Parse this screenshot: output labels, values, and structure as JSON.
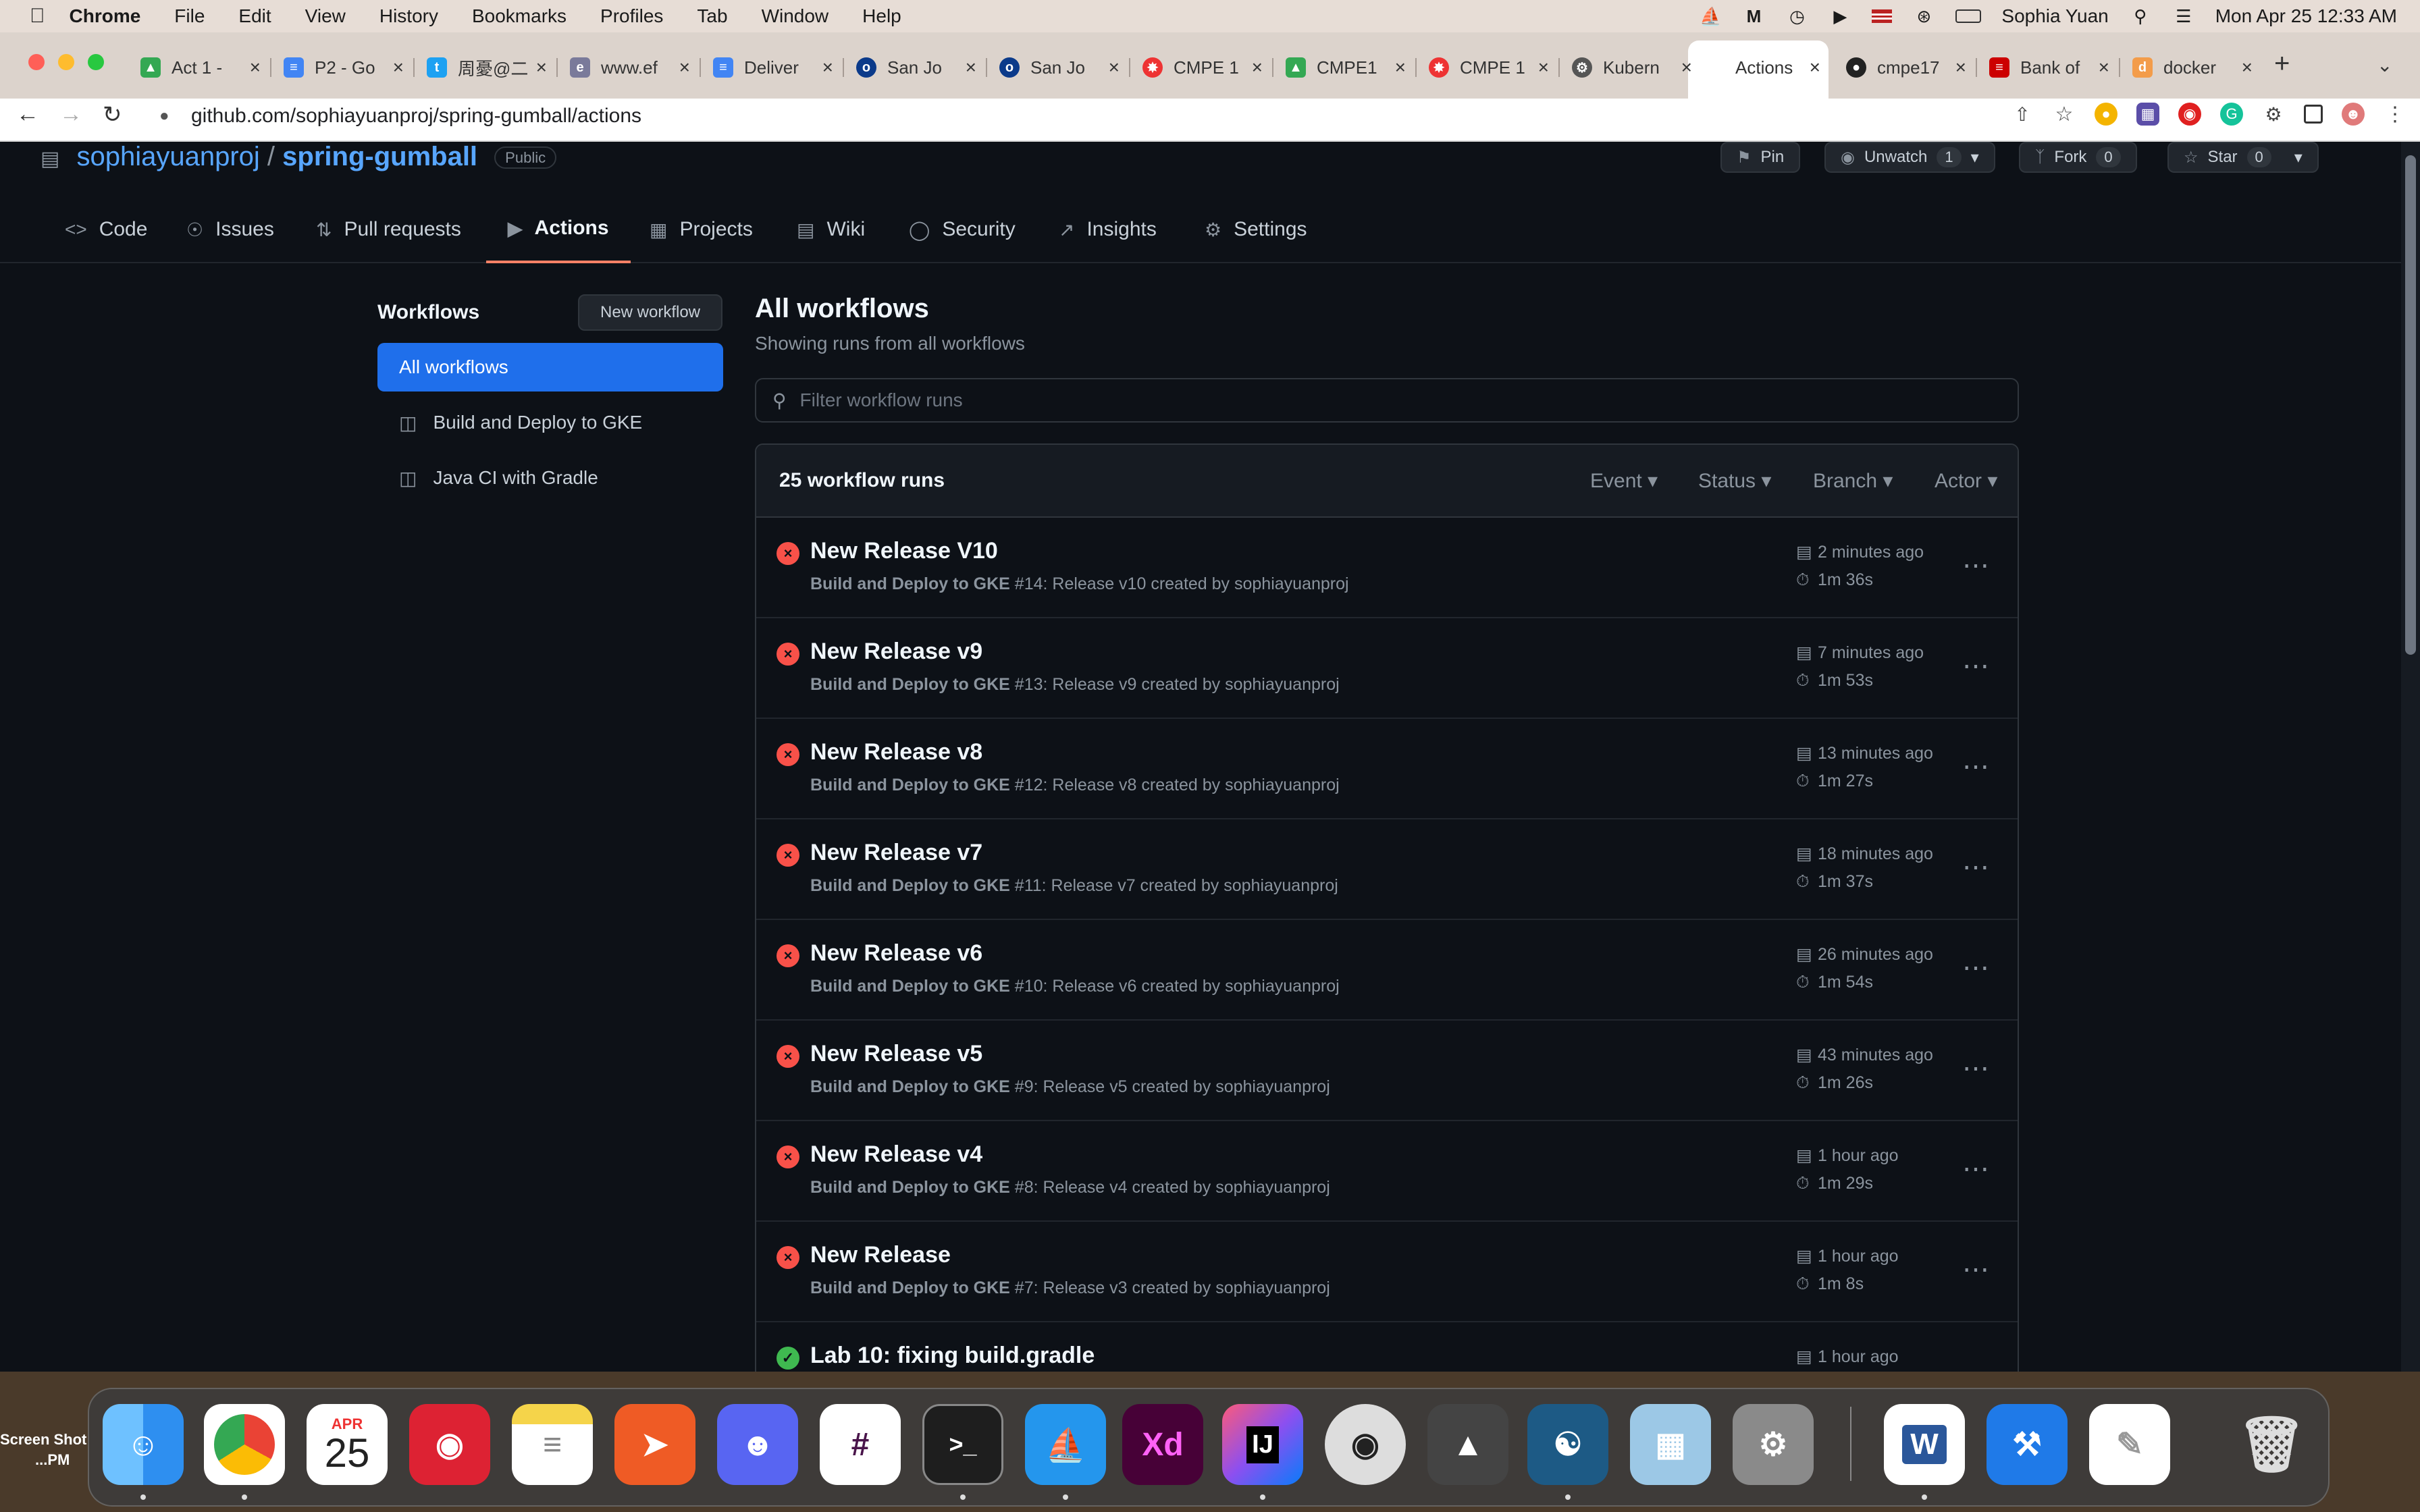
{
  "menubar": {
    "app": "Chrome",
    "items": [
      "File",
      "Edit",
      "View",
      "History",
      "Bookmarks",
      "Profiles",
      "Tab",
      "Window",
      "Help"
    ],
    "user": "Sophia Yuan",
    "datetime": "Mon Apr 25  12:33 AM"
  },
  "chrome": {
    "tabs": [
      {
        "label": "Act 1 - ",
        "icon": "google-drive-icon"
      },
      {
        "label": "P2 - Go",
        "icon": "google-docs-icon"
      },
      {
        "label": "周憂@二",
        "icon": "twitter-icon"
      },
      {
        "label": "www.ef",
        "icon": "globe-icon"
      },
      {
        "label": "Deliver",
        "icon": "google-docs-icon"
      },
      {
        "label": "San Jo",
        "icon": "sjsu-icon"
      },
      {
        "label": "San Jo",
        "icon": "sjsu-icon"
      },
      {
        "label": "CMPE 1",
        "icon": "canvas-icon"
      },
      {
        "label": "CMPE1",
        "icon": "google-drive-icon"
      },
      {
        "label": "CMPE 1",
        "icon": "canvas-icon"
      },
      {
        "label": "Kubern",
        "icon": "gear-icon"
      },
      {
        "label": "Actions",
        "icon": "github-icon",
        "active": true
      },
      {
        "label": "cmpe17",
        "icon": "github-icon"
      },
      {
        "label": "Bank of",
        "icon": "bank-icon"
      },
      {
        "label": "docker",
        "icon": "docker-icon"
      }
    ],
    "url": "github.com/sophiayuanproj/spring-gumball/actions"
  },
  "repo": {
    "owner": "sophiayuanproj",
    "name": "spring-gumball",
    "visibility": "Public",
    "pin_label": "Pin",
    "unwatch_label": "Unwatch",
    "watch_count": "1",
    "fork_label": "Fork",
    "fork_count": "0",
    "star_label": "Star",
    "star_count": "0"
  },
  "repo_nav": [
    {
      "label": "Code",
      "icon": "code-icon"
    },
    {
      "label": "Issues",
      "icon": "issue-icon"
    },
    {
      "label": "Pull requests",
      "icon": "pull-request-icon"
    },
    {
      "label": "Actions",
      "icon": "play-icon",
      "active": true
    },
    {
      "label": "Projects",
      "icon": "table-icon"
    },
    {
      "label": "Wiki",
      "icon": "book-icon"
    },
    {
      "label": "Security",
      "icon": "shield-icon"
    },
    {
      "label": "Insights",
      "icon": "graph-icon"
    },
    {
      "label": "Settings",
      "icon": "gear-icon"
    }
  ],
  "sidebar": {
    "title": "Workflows",
    "new_workflow": "New workflow",
    "items": [
      {
        "label": "All workflows",
        "active": true
      },
      {
        "label": "Build and Deploy to GKE"
      },
      {
        "label": "Java CI with Gradle"
      }
    ]
  },
  "main": {
    "title": "All workflows",
    "subtitle": "Showing runs from all workflows",
    "filter_placeholder": "Filter workflow runs",
    "runs_count": "25 workflow runs",
    "filters": [
      "Event",
      "Status",
      "Branch",
      "Actor"
    ],
    "runs": [
      {
        "title": "New Release V10",
        "workflow": "Build and Deploy to GKE",
        "detail": " #14: Release v10 created by sophiayuanproj",
        "time": "2 minutes ago",
        "duration": "1m 36s",
        "status": "failed"
      },
      {
        "title": "New Release v9",
        "workflow": "Build and Deploy to GKE",
        "detail": " #13: Release v9 created by sophiayuanproj",
        "time": "7 minutes ago",
        "duration": "1m 53s",
        "status": "failed"
      },
      {
        "title": "New Release v8",
        "workflow": "Build and Deploy to GKE",
        "detail": " #12: Release v8 created by sophiayuanproj",
        "time": "13 minutes ago",
        "duration": "1m 27s",
        "status": "failed"
      },
      {
        "title": "New Release v7",
        "workflow": "Build and Deploy to GKE",
        "detail": " #11: Release v7 created by sophiayuanproj",
        "time": "18 minutes ago",
        "duration": "1m 37s",
        "status": "failed"
      },
      {
        "title": "New Release v6",
        "workflow": "Build and Deploy to GKE",
        "detail": " #10: Release v6 created by sophiayuanproj",
        "time": "26 minutes ago",
        "duration": "1m 54s",
        "status": "failed"
      },
      {
        "title": "New Release v5",
        "workflow": "Build and Deploy to GKE",
        "detail": " #9: Release v5 created by sophiayuanproj",
        "time": "43 minutes ago",
        "duration": "1m 26s",
        "status": "failed"
      },
      {
        "title": "New Release v4",
        "workflow": "Build and Deploy to GKE",
        "detail": " #8: Release v4 created by sophiayuanproj",
        "time": "1 hour ago",
        "duration": "1m 29s",
        "status": "failed"
      },
      {
        "title": "New Release",
        "workflow": "Build and Deploy to GKE",
        "detail": " #7: Release v3 created by sophiayuanproj",
        "time": "1 hour ago",
        "duration": "1m 8s",
        "status": "failed"
      },
      {
        "title": "Lab 10: fixing build.gradle",
        "workflow": "",
        "detail": "",
        "time": "1 hour ago",
        "duration": "",
        "status": "success"
      }
    ]
  },
  "desktop": {
    "label_1": "Screen Shot",
    "label_2": "...PM"
  },
  "dock": {
    "calendar_month": "APR",
    "calendar_day": "25"
  }
}
